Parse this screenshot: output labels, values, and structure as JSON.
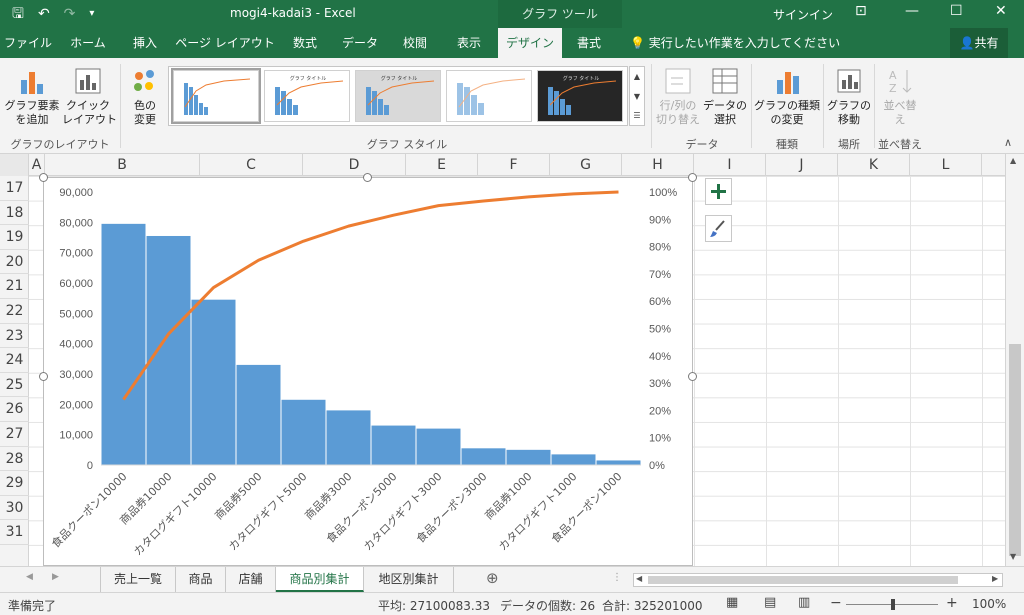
{
  "titlebar": {
    "title": "mogi4-kadai3  -  Excel",
    "context_tools": "グラフ ツール",
    "signin": "サインイン"
  },
  "tabs": [
    {
      "label": "ファイル"
    },
    {
      "label": "ホーム"
    },
    {
      "label": "挿入"
    },
    {
      "label": "ページ レイアウト"
    },
    {
      "label": "数式"
    },
    {
      "label": "データ"
    },
    {
      "label": "校閲"
    },
    {
      "label": "表示"
    },
    {
      "label": "デザイン"
    },
    {
      "label": "書式"
    }
  ],
  "tell_me": "実行したい作業を入力してください",
  "share_label": "共有",
  "ribbon": {
    "add_element": "グラフ要素\nを追加",
    "quick_layout": "クイック\nレイアウト",
    "change_color": "色の\n変更",
    "switch_rowcol": "行/列の\n切り替え",
    "select_data": "データの\n選択",
    "change_type": "グラフの種類\nの変更",
    "move_chart": "グラフの\n移動",
    "sort": "並べ替\nえ",
    "group_layout": "グラフのレイアウト",
    "group_style": "グラフ スタイル",
    "group_data": "データ",
    "group_type": "種類",
    "group_location": "場所",
    "group_sort": "並べ替え",
    "thumb_title": "グラフ タイトル"
  },
  "columns": [
    "A",
    "B",
    "C",
    "D",
    "E",
    "F",
    "G",
    "H",
    "I",
    "J",
    "K",
    "L"
  ],
  "rows": [
    "17",
    "18",
    "19",
    "20",
    "21",
    "22",
    "23",
    "24",
    "25",
    "26",
    "27",
    "28",
    "29",
    "30",
    "31"
  ],
  "chart_data": {
    "type": "bar",
    "categories": [
      "食品クーポン10000",
      "商品券10000",
      "カタログギフト10000",
      "商品券5000",
      "カタログギフト5000",
      "商品券3000",
      "食品クーポン5000",
      "カタログギフト3000",
      "食品クーポン3000",
      "商品券1000",
      "カタログギフト1000",
      "食品クーポン1000"
    ],
    "values": [
      79500,
      75500,
      54500,
      33000,
      21500,
      18000,
      13000,
      12000,
      5500,
      5000,
      3500,
      1500
    ],
    "series": [
      {
        "values": [
          79500,
          75500,
          54500,
          33000,
          21500,
          18000,
          13000,
          12000,
          5500,
          5000,
          3500,
          1500
        ]
      },
      {
        "values": [
          0.24,
          0.48,
          0.65,
          0.75,
          0.82,
          0.875,
          0.915,
          0.95,
          0.967,
          0.982,
          0.993,
          1.0
        ]
      }
    ],
    "yticks": [
      "0",
      "10,000",
      "20,000",
      "30,000",
      "40,000",
      "50,000",
      "60,000",
      "70,000",
      "80,000",
      "90,000"
    ],
    "y2ticks": [
      "0%",
      "10%",
      "20%",
      "30%",
      "40%",
      "50%",
      "60%",
      "70%",
      "80%",
      "90%",
      "100%"
    ],
    "ylim": [
      0,
      90000
    ],
    "y2lim": [
      0,
      1
    ],
    "bar_color": "#5b9bd5",
    "line_color": "#ed7d31"
  },
  "sheets": [
    "売上一覧",
    "商品",
    "店舗",
    "商品別集計",
    "地区別集計"
  ],
  "active_sheet": "商品別集計",
  "status": {
    "ready": "準備完了",
    "average": "平均: 27100083.33",
    "count": "データの個数: 26",
    "sum": "合計: 325201000",
    "zoom": "100%"
  },
  "accent": "#217346"
}
